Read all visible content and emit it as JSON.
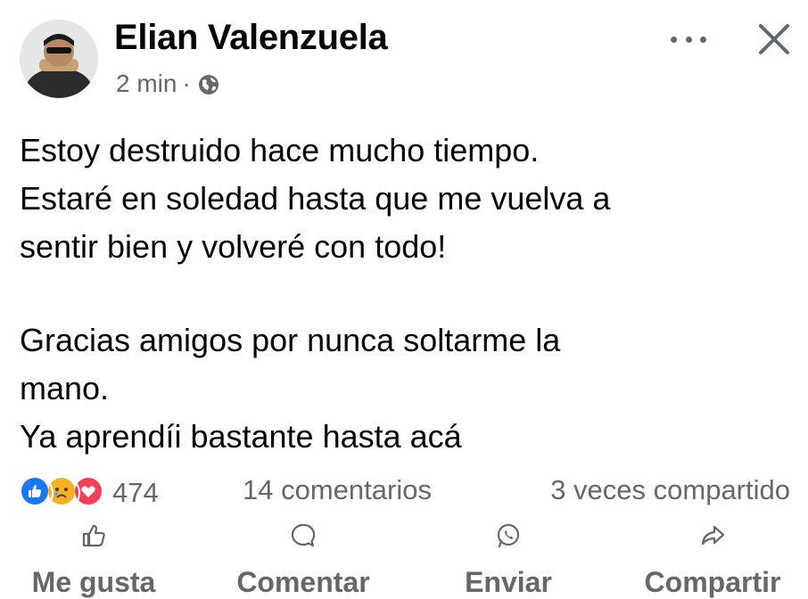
{
  "post": {
    "author_name": "Elian Valenzuela",
    "timestamp": "2 min",
    "separator": "·",
    "privacy_icon": "globe-icon",
    "more_icon": "more-options-icon",
    "close_icon": "close-icon"
  },
  "content": {
    "lines": [
      "Estoy destruido hace mucho tiempo.",
      "Estaré en soledad hasta que me vuelva a",
      "sentir bien y volveré con todo!",
      "",
      "Gracias amigos por nunca soltarme la",
      "mano.",
      "Ya aprendíi bastante hasta acá"
    ]
  },
  "stats": {
    "reaction_icons": [
      "like-reaction-icon",
      "sad-reaction-icon",
      "love-reaction-icon"
    ],
    "reaction_count": "474",
    "comments": "14 comentarios",
    "shares": "3 veces compartido"
  },
  "actions": {
    "like": "Me gusta",
    "comment": "Comentar",
    "send": "Enviar",
    "share": "Compartir"
  },
  "colors": {
    "text": "#050505",
    "secondary": "#65676b",
    "like_blue": "#1877f2",
    "love_red": "#f33e58",
    "sad_yellow": "#f7b125"
  }
}
